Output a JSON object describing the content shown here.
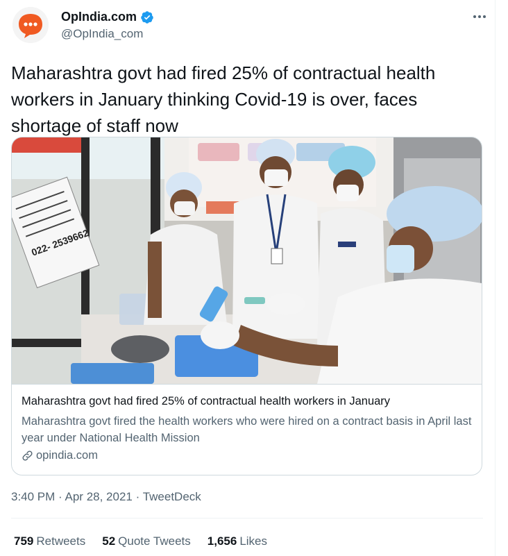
{
  "author": {
    "name": "OpIndia.com",
    "handle": "@OpIndia_com",
    "verified": true
  },
  "tweet": {
    "text": "Maharashtra govt had fired 25% of contractual health workers in January thinking Covid-19 is over, faces shortage of staff now"
  },
  "card": {
    "title": "Maharashtra govt had fired 25% of contractual health workers in January",
    "description": "Maharashtra govt fired the health workers who were hired on a contract basis in April last year under National Health Mission",
    "domain": "opindia.com",
    "image_sign_text": "022- 2539662"
  },
  "meta": {
    "time": "3:40 PM",
    "date": "Apr 28, 2021",
    "source": "TweetDeck",
    "separator": "·"
  },
  "stats": [
    {
      "count": "759",
      "label": "Retweets"
    },
    {
      "count": "52",
      "label": "Quote Tweets"
    },
    {
      "count": "1,656",
      "label": "Likes"
    }
  ],
  "colors": {
    "accent": "#1d9bf0",
    "brand_orange": "#f05a22",
    "secondary_text": "#536471"
  }
}
